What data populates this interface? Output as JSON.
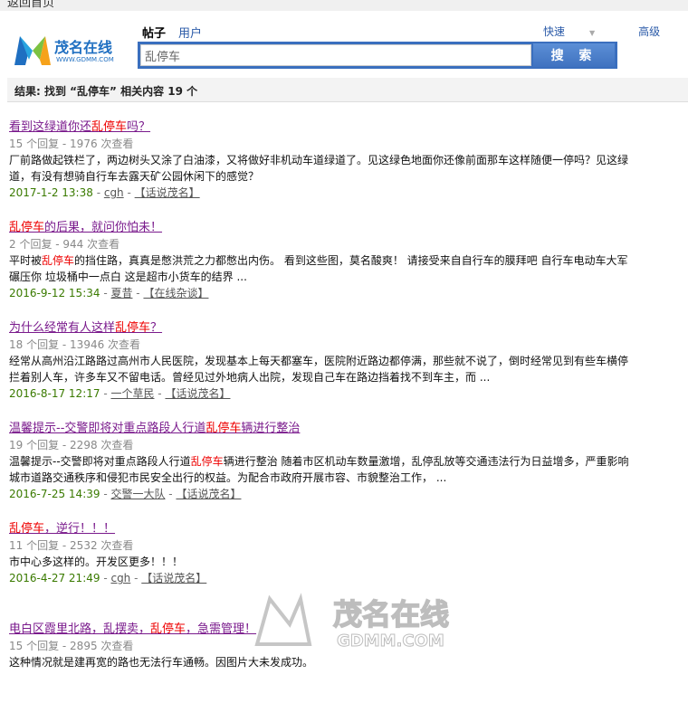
{
  "topbar": {
    "back_home": "返回首页"
  },
  "logo": {
    "text": "茂名在线",
    "url_text": "WWW.GDMM.COM"
  },
  "search": {
    "tabs": [
      "帖子",
      "用户"
    ],
    "value": "乱停车",
    "button": "搜 索",
    "quick": "快速",
    "advanced": "高级"
  },
  "summary": "结果: 找到 “乱停车” 相关内容 19 个",
  "results": [
    {
      "title": [
        [
          "看到这绿道你还",
          0
        ],
        [
          "乱停车",
          1
        ],
        [
          "吗？",
          0
        ]
      ],
      "meta": "15 个回复 - 1976 次查看",
      "body": [
        [
          "厂前路做起铁栏了，两边树头又涂了白油漆，又将做好非机动车道绿道了。见这绿色地面你还像前面那车这样随便一停吗？见这绿道，有没有想骑自行车去露天矿公园休闲下的感觉？",
          0
        ]
      ],
      "date": "2017-1-2 13:38",
      "author": "cgh",
      "forum": "【话说茂名】"
    },
    {
      "title": [
        [
          "乱停车",
          1
        ],
        [
          "的后果，就问你怕未！",
          0
        ]
      ],
      "meta": "2 个回复 - 944 次查看",
      "body": [
        [
          "平时被",
          0
        ],
        [
          "乱停车",
          1
        ],
        [
          "的挡住路，真真是憋洪荒之力都憋出内伤。 看到这些图，莫名酸爽！ 请接受来自自行车的膜拜吧 自行车电动车大军碾压你 垃圾桶中一点白 这是超市小货车的结界 ...",
          0
        ]
      ],
      "date": "2016-9-12 15:34",
      "author": "夏昔",
      "forum": "【在线杂谈】"
    },
    {
      "title": [
        [
          "为什么经常有人这样",
          0
        ],
        [
          "乱停车",
          1
        ],
        [
          "？",
          0
        ]
      ],
      "meta": "18 个回复 - 13946 次查看",
      "body": [
        [
          "经常从高州沿江路路过高州市人民医院，发现基本上每天都塞车，医院附近路边都停满，那些就不说了，倒时经常见到有些车横停拦着别人车，许多车又不留电话。曾经见过外地病人出院，发现自己车在路边挡着找不到车主，而 ...",
          0
        ]
      ],
      "date": "2016-8-17 12:17",
      "author": "一个草民",
      "forum": "【话说茂名】"
    },
    {
      "title": [
        [
          "温馨提示--交警即将对重点路段人行道",
          0
        ],
        [
          "乱停车",
          1
        ],
        [
          "辆进行整治",
          0
        ]
      ],
      "meta": "19 个回复 - 2298 次查看",
      "body": [
        [
          "温馨提示--交警即将对重点路段人行道",
          0
        ],
        [
          "乱停车",
          1
        ],
        [
          "辆进行整治 随着市区机动车数量激增，乱停乱放等交通违法行为日益增多，严重影响城市道路交通秩序和侵犯市民安全出行的权益。为配合市政府开展市容、市貌整治工作， ...",
          0
        ]
      ],
      "date": "2016-7-25 14:39",
      "author": "交警一大队",
      "forum": "【话说茂名】"
    },
    {
      "title": [
        [
          "乱停车",
          1
        ],
        [
          "，逆行！！！",
          0
        ]
      ],
      "meta": "11 个回复 - 2532 次查看",
      "body": [
        [
          "市中心多这样的。开发区更多！！！",
          0
        ]
      ],
      "date": "2016-4-27 21:49",
      "author": "cgh",
      "forum": "【话说茂名】"
    },
    {
      "title": [
        [
          "电白区霞里北路，乱摆卖，",
          0
        ],
        [
          "乱停车",
          1
        ],
        [
          "，急需管理！",
          0
        ]
      ],
      "meta": "15 个回复 - 2895 次查看",
      "body": [
        [
          "这种情况就是建再宽的路也无法行车通畅。因图片大未发成功。",
          0
        ]
      ]
    }
  ],
  "watermark": {
    "text": "茂名在线",
    "url_text": "GDMM.COM"
  }
}
